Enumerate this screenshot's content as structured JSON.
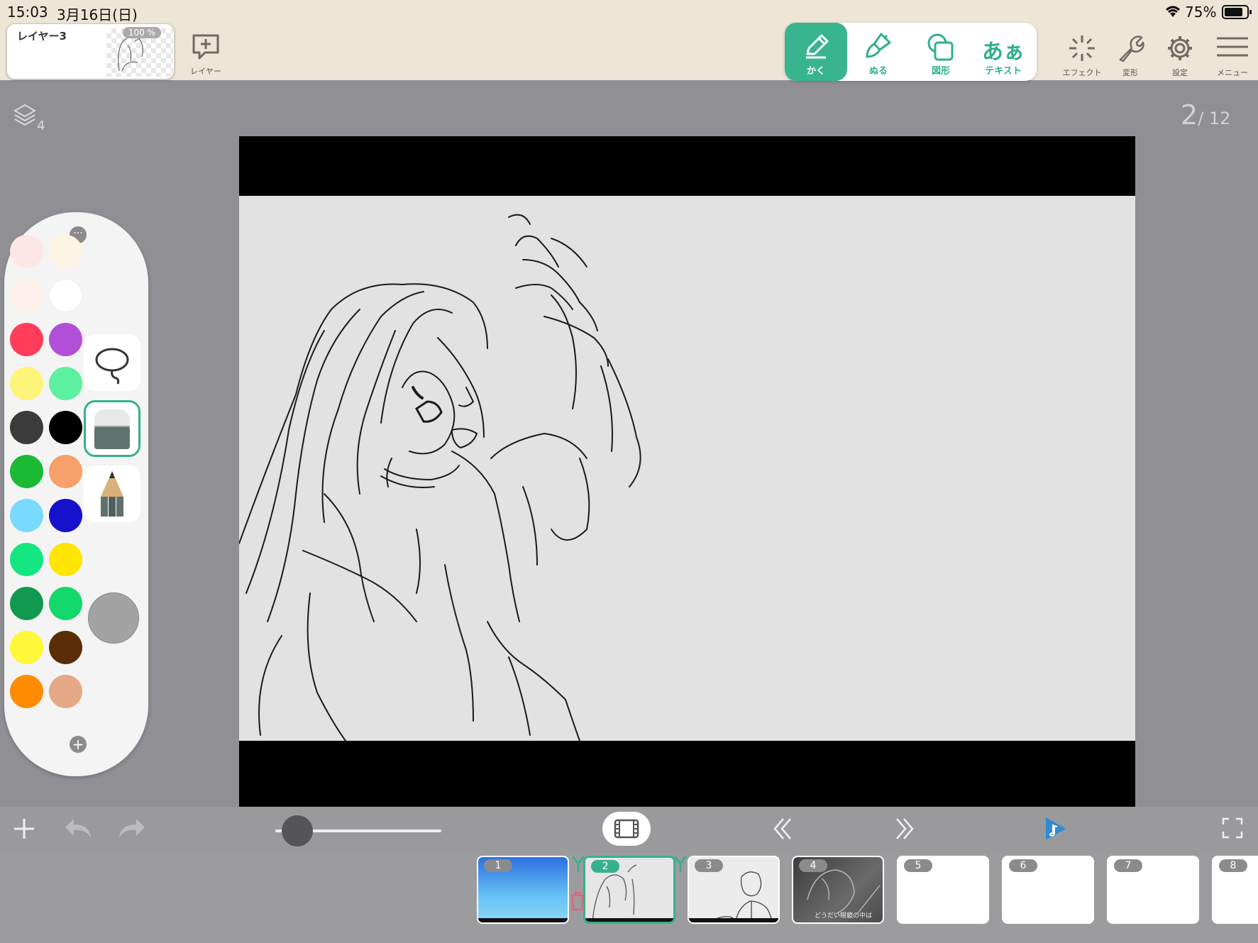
{
  "status_bar": {
    "time": "15:03",
    "date": "3月16日(日)",
    "battery": "75%"
  },
  "layer_card": {
    "name": "レイヤー3",
    "opacity": "100 %"
  },
  "top_toolbar": {
    "add_layer_label": "レイヤー",
    "tools": [
      {
        "id": "draw",
        "label": "かく",
        "active": true
      },
      {
        "id": "fill",
        "label": "ぬる",
        "active": false
      },
      {
        "id": "shape",
        "label": "図形",
        "active": false
      },
      {
        "id": "text",
        "label": "テキスト",
        "glyph": "あぁ",
        "active": false
      }
    ],
    "right_items": [
      {
        "id": "effect",
        "label": "エフェクト"
      },
      {
        "id": "transform",
        "label": "変形"
      },
      {
        "id": "settings",
        "label": "設定"
      },
      {
        "id": "menu",
        "label": "メニュー"
      }
    ]
  },
  "layer_count": "4",
  "frame_counter": {
    "current": "2",
    "total": "/ 12"
  },
  "palette": {
    "left_column": [
      "#fde7e4",
      "#fdeedf",
      "#ff3d5a",
      "#fff47a",
      "#3b3b3b",
      "#1aba35",
      "#7ad9ff",
      "#13e680",
      "#119a4f",
      "#fff83a",
      "#ff8c00"
    ],
    "right_column": [
      "#fdf4e4",
      "#ffffff",
      "#b24fd8",
      "#5ef0a2",
      "#000000",
      "#f6a06a",
      "#1511cc",
      "#ffe500",
      "#13d86c",
      "#5b2d06",
      "#e5a985"
    ],
    "top_row_left_2": "#fdf0ea",
    "current_color": "#a3a3a3",
    "tools": [
      "lasso",
      "eraser",
      "pencil"
    ],
    "selected_tool": "eraser"
  },
  "bottom_bar": {
    "slider_value": 0.07
  },
  "timeline": {
    "frames": [
      {
        "num": "1",
        "kind": "sky"
      },
      {
        "num": "2",
        "kind": "sketch",
        "selected": true
      },
      {
        "num": "3",
        "kind": "sketch2"
      },
      {
        "num": "4",
        "kind": "dark",
        "caption": "どうだい眼鏡の中は"
      },
      {
        "num": "5",
        "kind": "empty"
      },
      {
        "num": "6",
        "kind": "empty"
      },
      {
        "num": "7",
        "kind": "empty"
      },
      {
        "num": "8",
        "kind": "empty"
      }
    ]
  },
  "colors": {
    "accent": "#38b58f",
    "play": "#2f8bd6"
  }
}
